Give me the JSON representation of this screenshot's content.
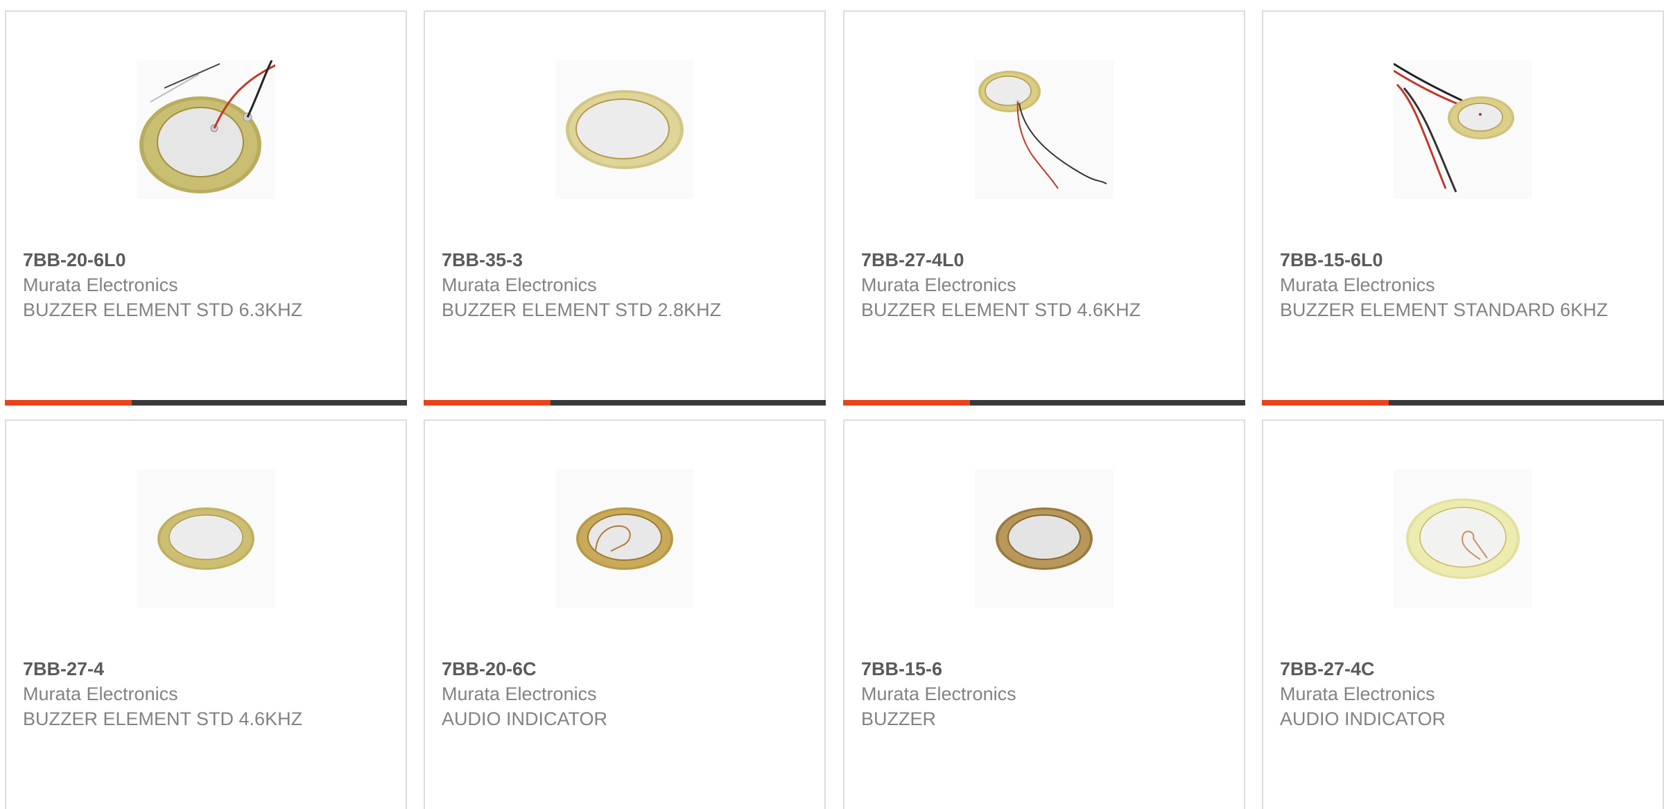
{
  "products": [
    {
      "part_number": "7BB-20-6L0",
      "manufacturer": "Murata Electronics",
      "description": "BUZZER ELEMENT STD 6.3KHZ",
      "image_icon": "piezo-disc-with-leads-icon"
    },
    {
      "part_number": "7BB-35-3",
      "manufacturer": "Murata Electronics",
      "description": "BUZZER ELEMENT STD 2.8KHZ",
      "image_icon": "piezo-disc-icon"
    },
    {
      "part_number": "7BB-27-4L0",
      "manufacturer": "Murata Electronics",
      "description": "BUZZER ELEMENT STD 4.6KHZ",
      "image_icon": "piezo-disc-with-leads-icon"
    },
    {
      "part_number": "7BB-15-6L0",
      "manufacturer": "Murata Electronics",
      "description": "BUZZER ELEMENT STANDARD 6KHZ",
      "image_icon": "piezo-disc-with-leads-icon"
    },
    {
      "part_number": "7BB-27-4",
      "manufacturer": "Murata Electronics",
      "description": "BUZZER ELEMENT STD 4.6KHZ",
      "image_icon": "piezo-disc-icon"
    },
    {
      "part_number": "7BB-20-6C",
      "manufacturer": "Murata Electronics",
      "description": "AUDIO INDICATOR",
      "image_icon": "piezo-disc-feedback-icon"
    },
    {
      "part_number": "7BB-15-6",
      "manufacturer": "Murata Electronics",
      "description": "BUZZER",
      "image_icon": "piezo-disc-icon"
    },
    {
      "part_number": "7BB-27-4C",
      "manufacturer": "Murata Electronics",
      "description": "AUDIO INDICATOR",
      "image_icon": "piezo-disc-feedback-icon"
    }
  ],
  "colors": {
    "accent": "#e8431b",
    "bar": "#3a3a3a",
    "part_number": "#5a5a5a",
    "secondary_text": "#828282",
    "card_border": "#dcdcdc"
  }
}
